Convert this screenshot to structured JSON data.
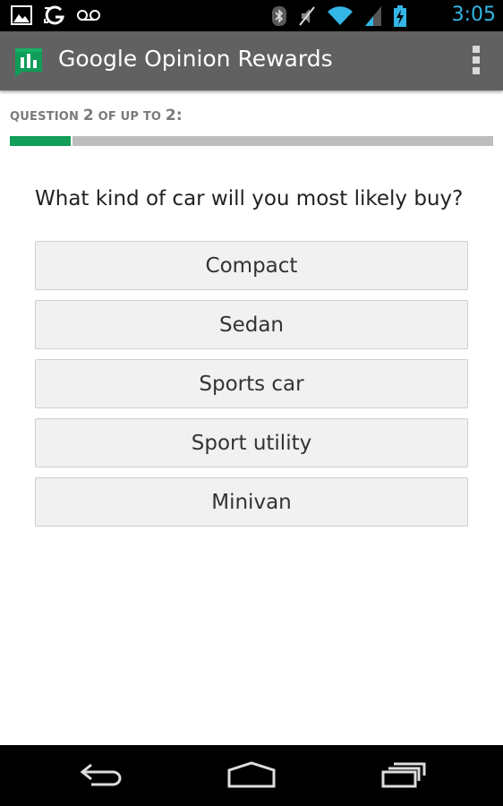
{
  "status_bar": {
    "time": "3:05",
    "time_color": "#33b5e5",
    "left_icons": [
      "gallery-icon",
      "sync-g-icon",
      "voicemail-icon"
    ],
    "right_icons": [
      "bluetooth-icon",
      "mute-icon",
      "wifi-icon",
      "signal-icon",
      "battery-charging-icon"
    ]
  },
  "action_bar": {
    "title": "Google Opinion Rewards",
    "app_icon": "opinion-rewards-icon",
    "menu_icon": "overflow-menu-icon"
  },
  "question": {
    "prefix": "QUESTION ",
    "number": "2",
    "middle": " OF UP TO ",
    "total": "2",
    "suffix": ":",
    "text": "What kind of car will you most likely buy?",
    "progress_fraction": 0.125,
    "progress_color": "#0f9d58"
  },
  "answers": [
    {
      "label": "Compact"
    },
    {
      "label": "Sedan"
    },
    {
      "label": "Sports car"
    },
    {
      "label": "Sport utility"
    },
    {
      "label": "Minivan"
    }
  ],
  "nav_bar": {
    "icons": [
      "back-icon",
      "home-icon",
      "recent-apps-icon"
    ]
  }
}
